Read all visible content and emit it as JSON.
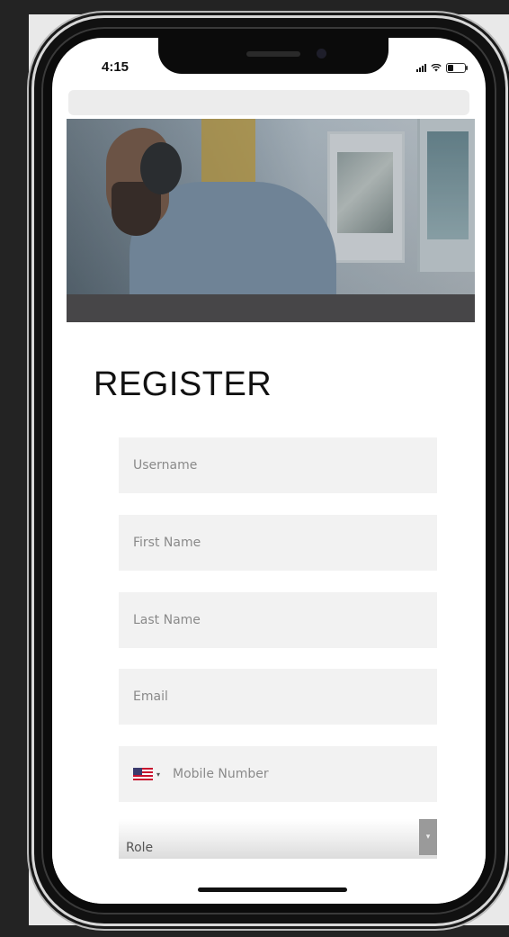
{
  "status_bar": {
    "time": "4:15"
  },
  "register": {
    "title": "REGISTER"
  },
  "fields": {
    "username_placeholder": "Username",
    "first_name_placeholder": "First Name",
    "last_name_placeholder": "Last Name",
    "email_placeholder": "Email",
    "mobile_placeholder": "Mobile Number",
    "country_flag": "us-flag-icon"
  },
  "role": {
    "label": "Role"
  },
  "colors": {
    "field_background": "#f2f2f2",
    "title_text": "#111111"
  }
}
